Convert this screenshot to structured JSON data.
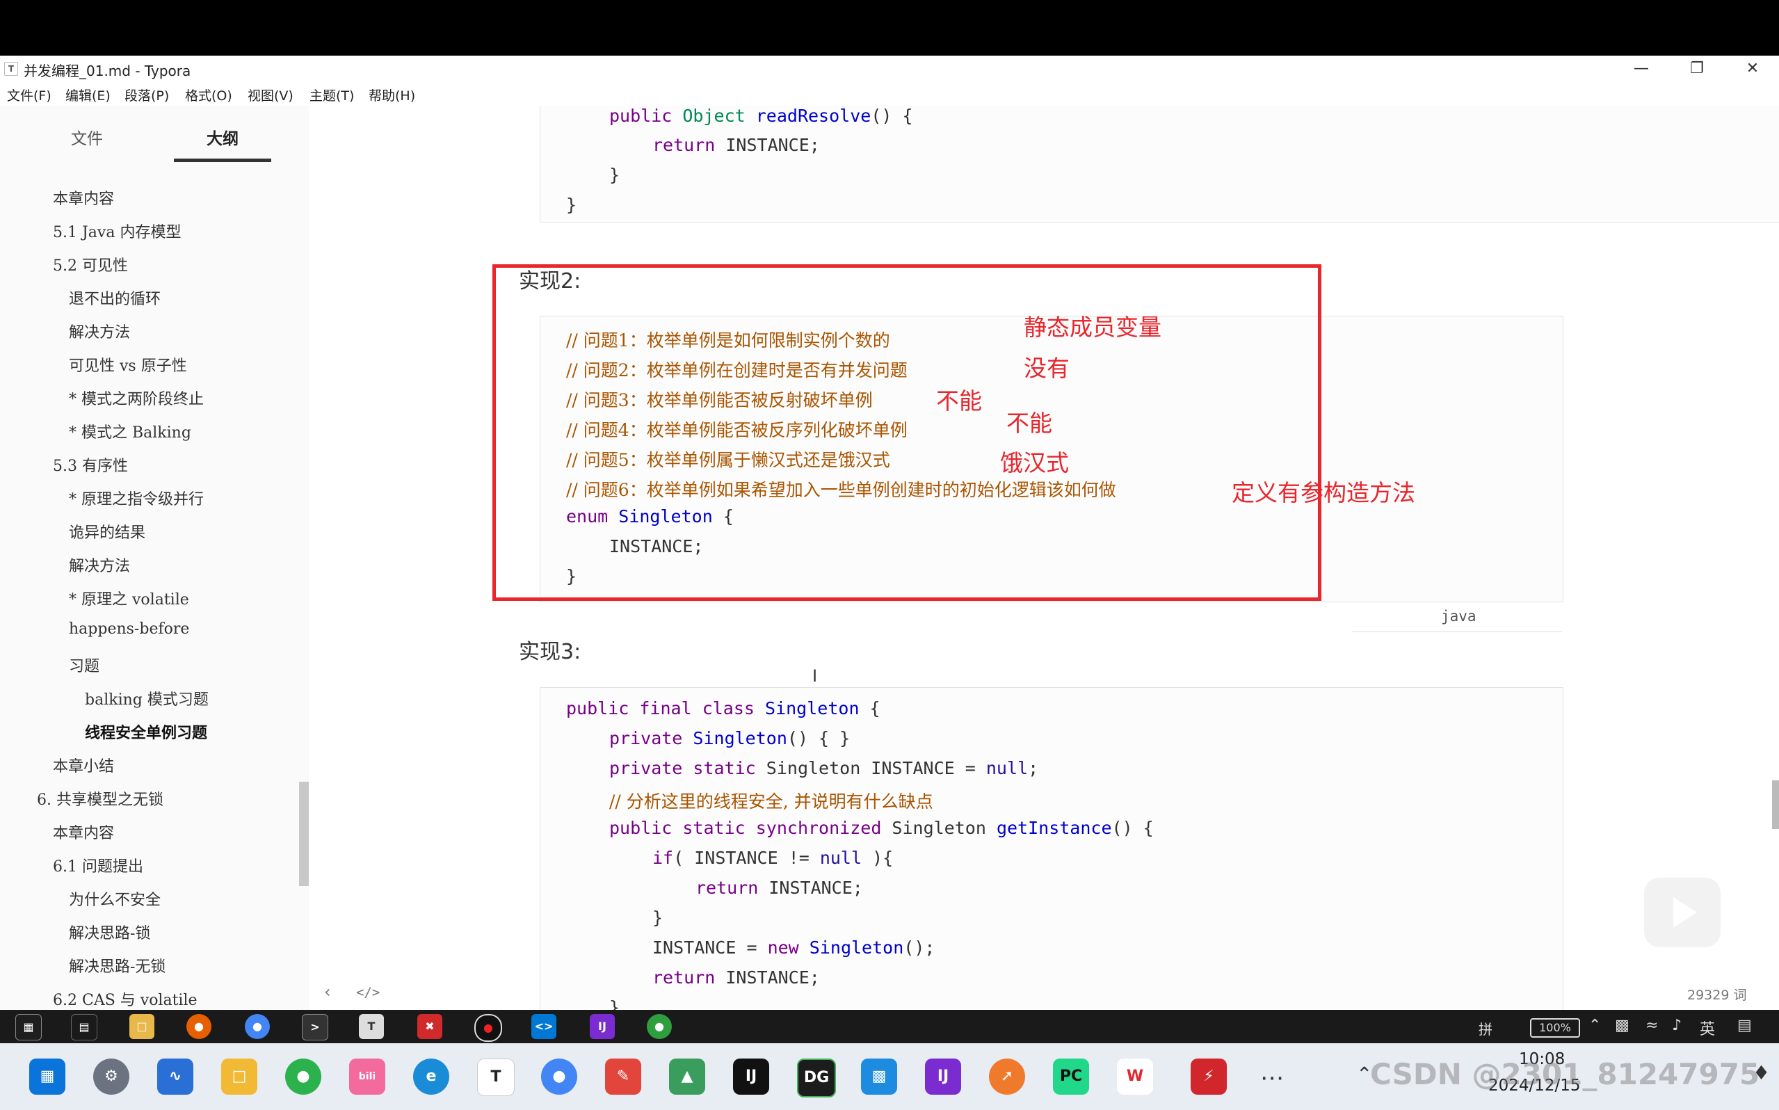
{
  "window": {
    "title": "并发编程_01.md - Typora",
    "app_icon": "T"
  },
  "menu": [
    "文件(F)",
    "编辑(E)",
    "段落(P)",
    "格式(O)",
    "视图(V)",
    "主题(T)",
    "帮助(H)"
  ],
  "sidebar": {
    "tabs": [
      "文件",
      "大纲"
    ],
    "outline": [
      "本章内容",
      "5.1 Java 内存模型",
      "5.2 可见性",
      "退不出的循环",
      "解决方法",
      "可见性 vs 原子性",
      "* 模式之两阶段终止",
      "* 模式之 Balking",
      "5.3 有序性",
      "* 原理之指令级并行",
      "诡异的结果",
      "解决方法",
      "* 原理之 volatile",
      "happens-before",
      "习题",
      "balking 模式习题",
      "线程安全单例习题",
      "本章小结",
      "6. 共享模型之无锁",
      "本章内容",
      "6.1 问题提出",
      "为什么不安全",
      "解决思路-锁",
      "解决思路-无锁",
      "6.2 CAS 与 volatile"
    ]
  },
  "content": {
    "heading2": "实现2:",
    "heading3": "实现3:",
    "code_lang": "java",
    "word_count": "29329 词"
  },
  "annotations": [
    "静态成员变量",
    "没有",
    "不能",
    "不能",
    "饿汉式",
    "定义有参构造方法"
  ],
  "taskbar": {
    "time": "10:08",
    "date": "2024/12/15",
    "battery": "100%",
    "ime": "英",
    "ime2": "拼"
  },
  "watermarks": [
    "bilibili",
    "CSDN @2301_81247975"
  ]
}
